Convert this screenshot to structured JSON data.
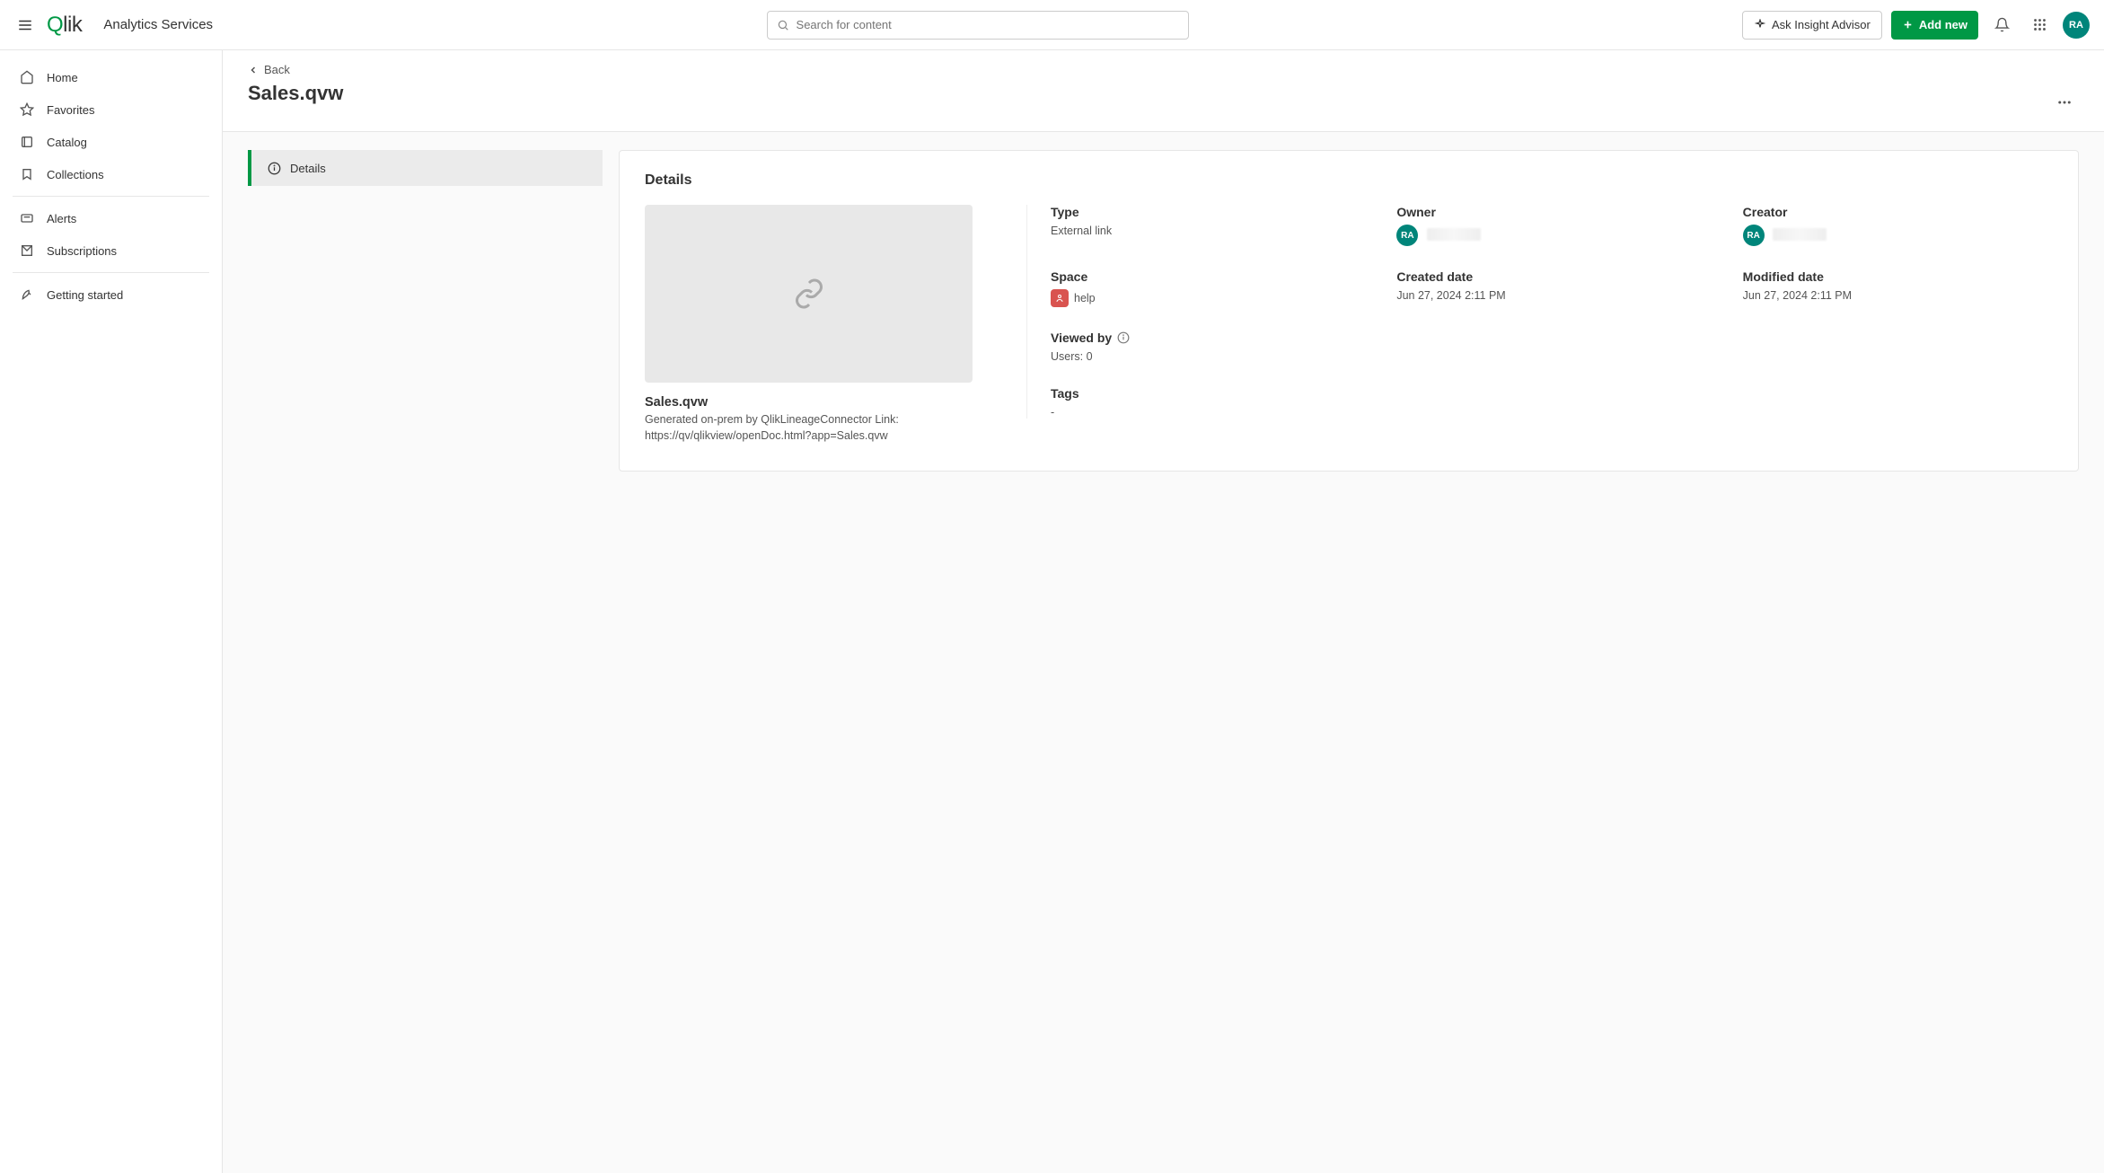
{
  "header": {
    "app_name": "Analytics Services",
    "search_placeholder": "Search for content",
    "ask_insight_label": "Ask Insight Advisor",
    "add_new_label": "Add new",
    "user_initials": "RA"
  },
  "sidebar": {
    "items": [
      {
        "icon": "home",
        "label": "Home"
      },
      {
        "icon": "star",
        "label": "Favorites"
      },
      {
        "icon": "catalog",
        "label": "Catalog"
      },
      {
        "icon": "collections",
        "label": "Collections"
      },
      {
        "icon": "divider"
      },
      {
        "icon": "alerts",
        "label": "Alerts"
      },
      {
        "icon": "subscriptions",
        "label": "Subscriptions"
      },
      {
        "icon": "divider"
      },
      {
        "icon": "rocket",
        "label": "Getting started"
      }
    ]
  },
  "page": {
    "back_label": "Back",
    "title": "Sales.qvw"
  },
  "side_tabs": [
    {
      "label": "Details",
      "icon": "info",
      "active": true
    }
  ],
  "details": {
    "section_title": "Details",
    "item_title": "Sales.qvw",
    "item_desc": "Generated on-prem by QlikLineageConnector Link: https://qv/qlikview/openDoc.html?app=Sales.qvw",
    "meta": {
      "type_label": "Type",
      "type_value": "External link",
      "owner_label": "Owner",
      "owner_initials": "RA",
      "creator_label": "Creator",
      "creator_initials": "RA",
      "space_label": "Space",
      "space_value": "help",
      "created_label": "Created date",
      "created_value": "Jun 27, 2024 2:11 PM",
      "modified_label": "Modified date",
      "modified_value": "Jun 27, 2024 2:11 PM",
      "viewed_label": "Viewed by",
      "viewed_value": "Users: 0",
      "tags_label": "Tags",
      "tags_value": "-"
    }
  }
}
